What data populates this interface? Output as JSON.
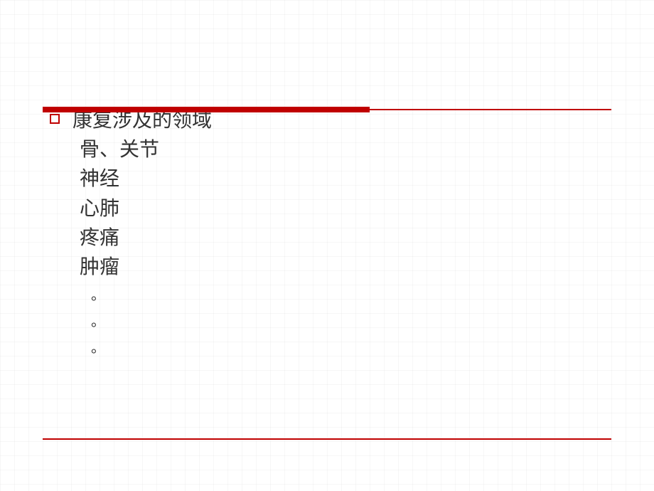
{
  "main": {
    "title": "康复涉及的领域",
    "items": [
      "骨、关节",
      "神经",
      "心肺",
      "疼痛",
      "肿瘤"
    ],
    "dots": [
      "。",
      "。",
      "。"
    ]
  }
}
